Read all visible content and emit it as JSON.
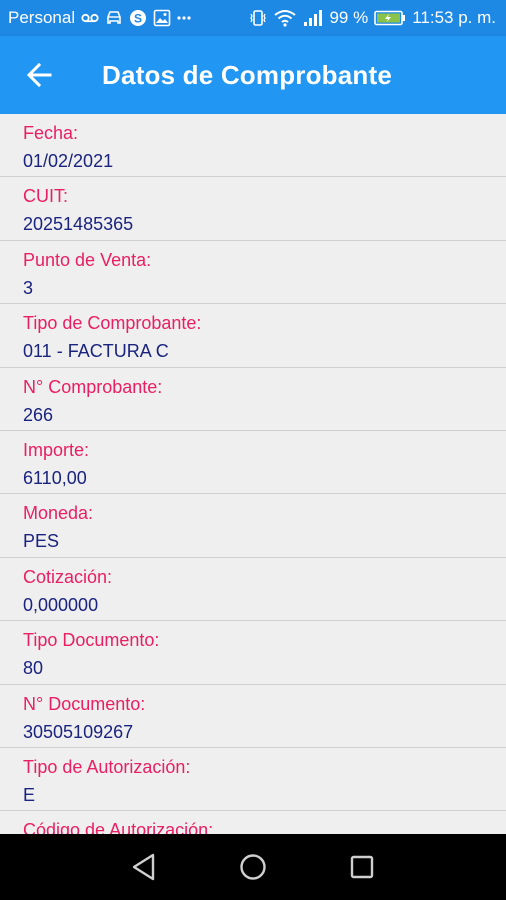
{
  "status_bar": {
    "carrier": "Personal",
    "battery_percent": "99 %",
    "time": "11:53 p. m."
  },
  "app_bar": {
    "title": "Datos de Comprobante",
    "back_icon": "arrow-back-icon"
  },
  "fields": [
    {
      "label": "Fecha:",
      "value": "01/02/2021"
    },
    {
      "label": "CUIT:",
      "value": "20251485365"
    },
    {
      "label": "Punto de Venta:",
      "value": "3"
    },
    {
      "label": "Tipo de Comprobante:",
      "value": "011 - FACTURA C"
    },
    {
      "label": "N° Comprobante:",
      "value": "266"
    },
    {
      "label": "Importe:",
      "value": "6110,00"
    },
    {
      "label": "Moneda:",
      "value": "PES"
    },
    {
      "label": "Cotización:",
      "value": "0,000000"
    },
    {
      "label": "Tipo Documento:",
      "value": "80"
    },
    {
      "label": "N° Documento:",
      "value": "30505109267"
    },
    {
      "label": "Tipo de Autorización:",
      "value": "E"
    },
    {
      "label": "Código de Autorización:",
      "value": ""
    }
  ],
  "colors": {
    "status_bar": "#1e88e5",
    "app_bar": "#2196f3",
    "label": "#e91e63",
    "value": "#1a237e",
    "background": "#efefef"
  }
}
